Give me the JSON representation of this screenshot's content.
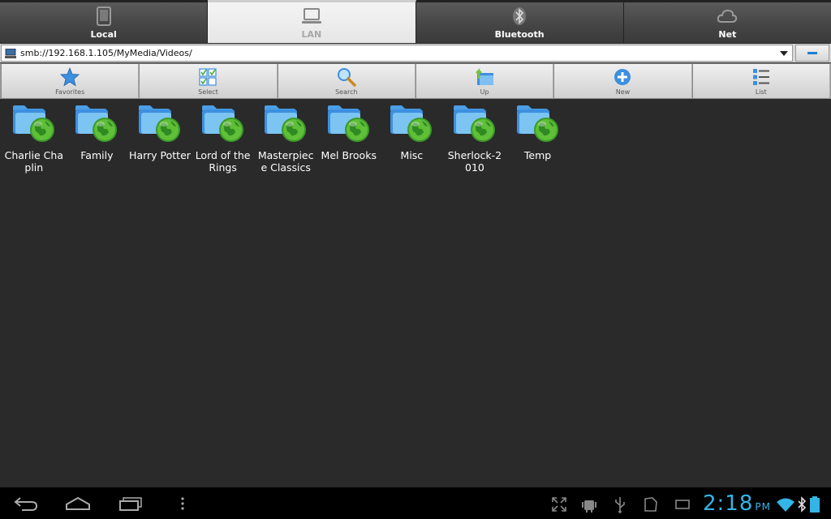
{
  "tabs": [
    {
      "label": "Local",
      "icon": "tablet-icon",
      "active": false
    },
    {
      "label": "LAN",
      "icon": "laptop-icon",
      "active": true
    },
    {
      "label": "Bluetooth",
      "icon": "bluetooth-icon",
      "active": false
    },
    {
      "label": "Net",
      "icon": "cloud-icon",
      "active": false
    }
  ],
  "pathbar": {
    "path": "smb://192.168.1.105/MyMedia/Videos/"
  },
  "toolbar": [
    {
      "label": "Favorites",
      "icon": "star-icon"
    },
    {
      "label": "Select",
      "icon": "select-grid-icon"
    },
    {
      "label": "Search",
      "icon": "magnifier-icon"
    },
    {
      "label": "Up",
      "icon": "folder-up-icon"
    },
    {
      "label": "New",
      "icon": "plus-circle-icon"
    },
    {
      "label": "List",
      "icon": "list-icon"
    }
  ],
  "files": [
    {
      "name": "Charlie Chaplin"
    },
    {
      "name": "Family"
    },
    {
      "name": "Harry Potter"
    },
    {
      "name": "Lord of the Rings"
    },
    {
      "name": "Masterpiec e Classics"
    },
    {
      "name": "Mel Brooks"
    },
    {
      "name": "Misc"
    },
    {
      "name": "Sherlock-2 010"
    },
    {
      "name": "Temp"
    }
  ],
  "status": {
    "time": "2:18",
    "ampm": "PM"
  },
  "colors": {
    "accent": "#33b5e5",
    "background": "#2a2a2a"
  }
}
